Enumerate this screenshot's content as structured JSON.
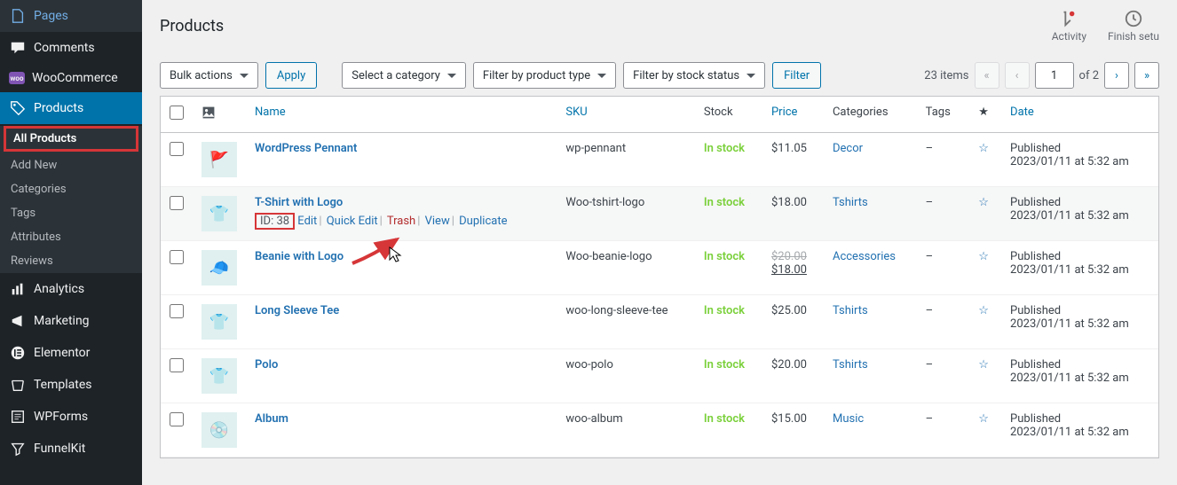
{
  "sidebar": {
    "items": [
      {
        "icon": "pages",
        "label": "Pages"
      },
      {
        "icon": "comments",
        "label": "Comments"
      },
      {
        "icon": "woo",
        "label": "WooCommerce"
      },
      {
        "icon": "products",
        "label": "Products",
        "open": true
      },
      {
        "icon": "analytics",
        "label": "Analytics"
      },
      {
        "icon": "marketing",
        "label": "Marketing"
      },
      {
        "icon": "elementor",
        "label": "Elementor"
      },
      {
        "icon": "templates",
        "label": "Templates"
      },
      {
        "icon": "wpforms",
        "label": "WPForms"
      },
      {
        "icon": "funnelkit",
        "label": "FunnelKit"
      }
    ],
    "submenu": [
      {
        "label": "All Products",
        "current": true,
        "boxed": true
      },
      {
        "label": "Add New"
      },
      {
        "label": "Categories"
      },
      {
        "label": "Tags"
      },
      {
        "label": "Attributes"
      },
      {
        "label": "Reviews"
      }
    ]
  },
  "header": {
    "title": "Products",
    "activity": "Activity",
    "finish": "Finish setu"
  },
  "filters": {
    "bulk": "Bulk actions",
    "apply": "Apply",
    "category": "Select a category",
    "type": "Filter by product type",
    "stock": "Filter by stock status",
    "filter": "Filter",
    "count": "23 items",
    "page": "1",
    "of": "of 2"
  },
  "columns": {
    "name": "Name",
    "sku": "SKU",
    "stock": "Stock",
    "price": "Price",
    "categories": "Categories",
    "tags": "Tags",
    "date": "Date"
  },
  "row_actions": {
    "id_prefix": "ID: ",
    "edit": "Edit",
    "quick": "Quick Edit",
    "trash": "Trash",
    "view": "View",
    "duplicate": "Duplicate"
  },
  "rows": [
    {
      "thumb": "🚩",
      "name": "WordPress Pennant",
      "sku": "wp-pennant",
      "stock": "In stock",
      "price": "$11.05",
      "cat": "Decor",
      "tags": "–",
      "pub": "Published",
      "date": "2023/01/11 at 5:32 am"
    },
    {
      "thumb": "👕",
      "name": "T-Shirt with Logo",
      "id": "38",
      "sku": "Woo-tshirt-logo",
      "stock": "In stock",
      "price": "$18.00",
      "cat": "Tshirts",
      "tags": "–",
      "pub": "Published",
      "date": "2023/01/11 at 5:32 am",
      "hover": true
    },
    {
      "thumb": "🧢",
      "name": "Beanie with Logo",
      "sku": "Woo-beanie-logo",
      "stock": "In stock",
      "price_strike": "$20.00",
      "price_sale": "$18.00",
      "cat": "Accessories",
      "tags": "–",
      "pub": "Published",
      "date": "2023/01/11 at 5:32 am"
    },
    {
      "thumb": "👕",
      "name": "Long Sleeve Tee",
      "sku": "woo-long-sleeve-tee",
      "stock": "In stock",
      "price": "$25.00",
      "cat": "Tshirts",
      "tags": "–",
      "pub": "Published",
      "date": "2023/01/11 at 5:32 am"
    },
    {
      "thumb": "👕",
      "name": "Polo",
      "sku": "woo-polo",
      "stock": "In stock",
      "price": "$20.00",
      "cat": "Tshirts",
      "tags": "–",
      "pub": "Published",
      "date": "2023/01/11 at 5:32 am"
    },
    {
      "thumb": "💿",
      "name": "Album",
      "sku": "woo-album",
      "stock": "In stock",
      "price": "$15.00",
      "cat": "Music",
      "tags": "–",
      "pub": "Published",
      "date": "2023/01/11 at 5:32 am"
    }
  ]
}
